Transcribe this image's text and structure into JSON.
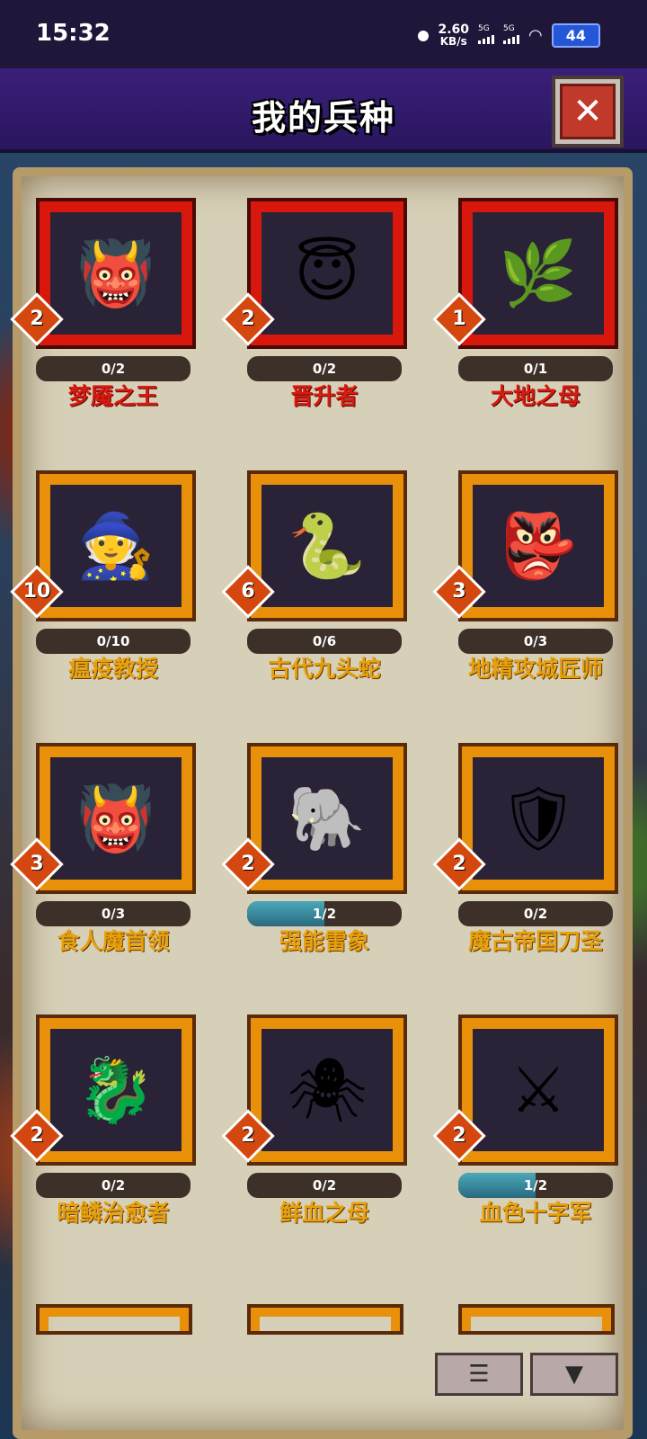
{
  "status_bar": {
    "time": "15:32",
    "speed_value": "2.60",
    "speed_unit": "KB/s",
    "sig1_label": "5G",
    "sig2_label": "5G",
    "battery": "44"
  },
  "header": {
    "title": "我的兵种",
    "close_icon": "close-icon"
  },
  "units": [
    {
      "name": "梦魇之王",
      "progress": "0/2",
      "count": "2",
      "level": 0,
      "rarity": "red",
      "icon": "👹"
    },
    {
      "name": "晋升者",
      "progress": "0/2",
      "count": "2",
      "level": 0,
      "rarity": "red",
      "icon": "😇"
    },
    {
      "name": "大地之母",
      "progress": "0/1",
      "count": "1",
      "level": 0,
      "rarity": "red",
      "icon": "🌿"
    },
    {
      "name": "瘟疫教授",
      "progress": "0/10",
      "count": "10",
      "level": 0,
      "rarity": "orange",
      "icon": "🧙"
    },
    {
      "name": "古代九头蛇",
      "progress": "0/6",
      "count": "6",
      "level": 0,
      "rarity": "orange",
      "icon": "🐍"
    },
    {
      "name": "地精攻城匠师",
      "progress": "0/3",
      "count": "3",
      "level": 0,
      "rarity": "orange",
      "icon": "👺"
    },
    {
      "name": "食人魔首领",
      "progress": "0/3",
      "count": "3",
      "level": 0,
      "rarity": "orange",
      "icon": "👹"
    },
    {
      "name": "强能雷象",
      "progress": "1/2",
      "count": "2",
      "level": 0.5,
      "rarity": "orange",
      "icon": "🐘"
    },
    {
      "name": "魔古帝国刀圣",
      "progress": "0/2",
      "count": "2",
      "level": 0,
      "rarity": "orange",
      "icon": "🛡"
    },
    {
      "name": "暗鳞治愈者",
      "progress": "0/2",
      "count": "2",
      "level": 0,
      "rarity": "orange",
      "icon": "🐉"
    },
    {
      "name": "鲜血之母",
      "progress": "0/2",
      "count": "2",
      "level": 0,
      "rarity": "orange",
      "icon": "🕷"
    },
    {
      "name": "血色十字军",
      "progress": "1/2",
      "count": "2",
      "level": 0.5,
      "rarity": "orange",
      "icon": "⚔"
    }
  ],
  "bottom_buttons": [
    {
      "icon": "list-icon",
      "glyph": "☰"
    },
    {
      "icon": "filter-icon",
      "glyph": "▼"
    }
  ]
}
